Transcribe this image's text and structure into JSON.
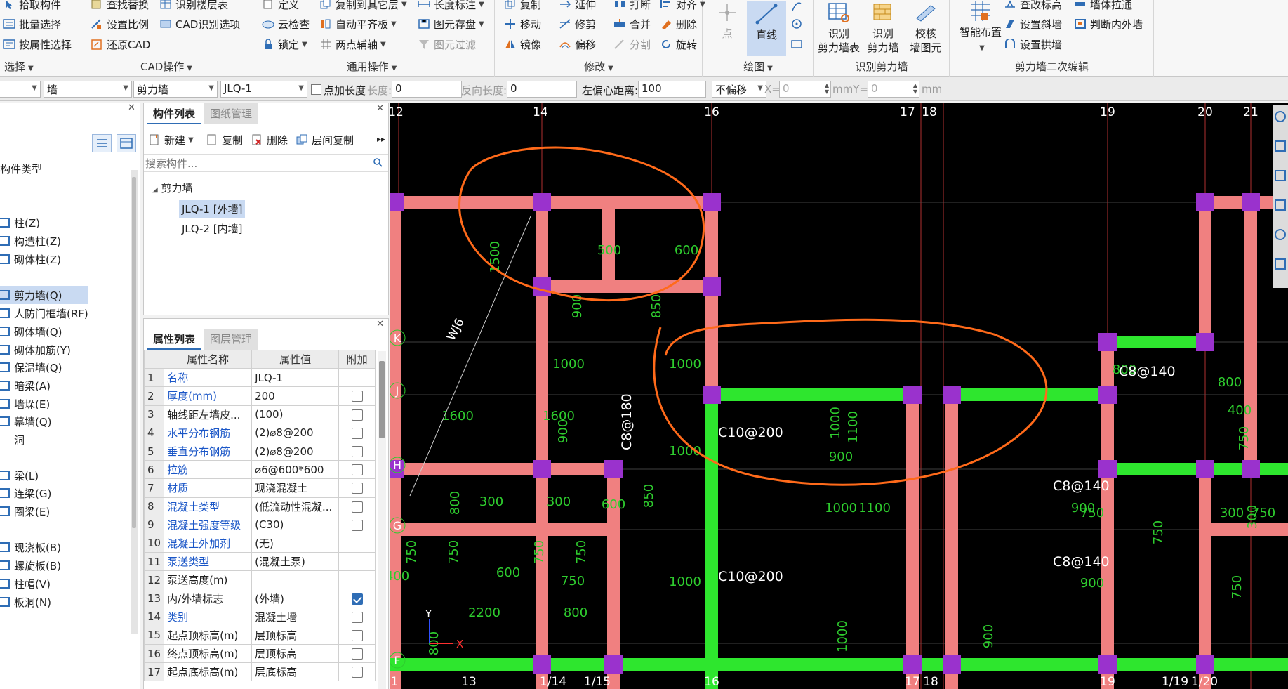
{
  "ribbon": {
    "select_group": {
      "items": [
        "拾取构件",
        "批量选择",
        "按属性选择"
      ],
      "title": "选择"
    },
    "cad_group": {
      "items": [
        "查找替换",
        "识别楼层表",
        "设置比例",
        "CAD识别选项",
        "还原CAD"
      ],
      "title": "CAD操作"
    },
    "common_group": {
      "items": [
        "定义",
        "复制到其它层",
        "长度标注",
        "云检查",
        "自动平齐板",
        "图元存盘",
        "锁定",
        "两点辅轴",
        "图元过滤"
      ],
      "title": "通用操作"
    },
    "modify_group": {
      "items": [
        "复制",
        "延伸",
        "打断",
        "对齐",
        "移动",
        "修剪",
        "合并",
        "删除",
        "镜像",
        "偏移",
        "分割",
        "旋转"
      ],
      "title": "修改"
    },
    "draw_group": {
      "items": [
        "点",
        "直线"
      ],
      "title": "绘图"
    },
    "recognize_group": {
      "items": [
        {
          "l1": "识别",
          "l2": "剪力墙表"
        },
        {
          "l1": "识别",
          "l2": "剪力墙"
        },
        {
          "l1": "校核",
          "l2": "墙图元"
        }
      ],
      "title": "识别剪力墙"
    },
    "second_edit_group": {
      "items": [
        "智能布置",
        "查改标高",
        "墙体拉通",
        "设置斜墙",
        "判断内外墙",
        "设置拱墙"
      ],
      "title": "剪力墙二次编辑"
    }
  },
  "options_bar": {
    "category": "墙",
    "type": "剪力墙",
    "component": "JLQ-1",
    "point_length_label": "点加长度",
    "length_label": "长度:",
    "length_value": "0",
    "reverse_length_label": "反向长度:",
    "reverse_length_value": "0",
    "left_offset_label": "左偏心距离:",
    "left_offset_value": "100",
    "offset_mode": "不偏移",
    "x_label": "X=",
    "x_value": "0",
    "mmy_label": "mmY=",
    "y_value": "0",
    "mm_label": "mm"
  },
  "left_nav": {
    "header": "构件类型",
    "items": [
      "柱(Z)",
      "构造柱(Z)",
      "砌体柱(Z)",
      "剪力墙(Q)",
      "人防门框墙(RF)",
      "砌体墙(Q)",
      "砌体加筋(Y)",
      "保温墙(Q)",
      "暗梁(A)",
      "墙垛(E)",
      "幕墙(Q)",
      "洞",
      "梁(L)",
      "连梁(G)",
      "圈梁(E)",
      "现浇板(B)",
      "螺旋板(B)",
      "柱帽(V)",
      "板洞(N)"
    ]
  },
  "component_list": {
    "tabs": [
      "构件列表",
      "图纸管理"
    ],
    "toolbar": [
      "新建",
      "复制",
      "删除",
      "层间复制"
    ],
    "search_placeholder": "搜索构件...",
    "tree_root": "剪力墙",
    "tree_items": [
      "JLQ-1 [外墙]",
      "JLQ-2 [内墙]"
    ]
  },
  "properties": {
    "tabs": [
      "属性列表",
      "图层管理"
    ],
    "headers": [
      "属性名称",
      "属性值",
      "附加"
    ],
    "rows": [
      {
        "num": "1",
        "name": "名称",
        "value": "JLQ-1",
        "link": true,
        "check": "none"
      },
      {
        "num": "2",
        "name": "厚度(mm)",
        "value": "200",
        "link": true,
        "check": "off"
      },
      {
        "num": "3",
        "name": "轴线距左墙皮...",
        "value": "(100)",
        "link": false,
        "check": "off"
      },
      {
        "num": "4",
        "name": "水平分布钢筋",
        "value": "(2)⌀8@200",
        "link": true,
        "check": "off"
      },
      {
        "num": "5",
        "name": "垂直分布钢筋",
        "value": "(2)⌀8@200",
        "link": true,
        "check": "off"
      },
      {
        "num": "6",
        "name": "拉筋",
        "value": "⌀6@600*600",
        "link": true,
        "check": "off"
      },
      {
        "num": "7",
        "name": "材质",
        "value": "现浇混凝土",
        "link": true,
        "check": "off"
      },
      {
        "num": "8",
        "name": "混凝土类型",
        "value": "(低流动性混凝...",
        "link": true,
        "check": "off"
      },
      {
        "num": "9",
        "name": "混凝土强度等级",
        "value": "(C30)",
        "link": true,
        "check": "off"
      },
      {
        "num": "10",
        "name": "混凝土外加剂",
        "value": "(无)",
        "link": true,
        "check": "none"
      },
      {
        "num": "11",
        "name": "泵送类型",
        "value": "(混凝土泵)",
        "link": true,
        "check": "none"
      },
      {
        "num": "12",
        "name": "泵送高度(m)",
        "value": "",
        "link": false,
        "check": "none"
      },
      {
        "num": "13",
        "name": "内/外墙标志",
        "value": "(外墙)",
        "link": false,
        "check": "on"
      },
      {
        "num": "14",
        "name": "类别",
        "value": "混凝土墙",
        "link": true,
        "check": "off"
      },
      {
        "num": "15",
        "name": "起点顶标高(m)",
        "value": "层顶标高",
        "link": false,
        "check": "off"
      },
      {
        "num": "16",
        "name": "终点顶标高(m)",
        "value": "层顶标高",
        "link": false,
        "check": "off"
      },
      {
        "num": "17",
        "name": "起点底标高(m)",
        "value": "层底标高",
        "link": false,
        "check": "off"
      }
    ]
  },
  "drawing": {
    "top_axes": [
      "12",
      "14",
      "16",
      "17",
      "18",
      "19",
      "20",
      "21"
    ],
    "side_axes": [
      "K",
      "J",
      "H",
      "G",
      "F"
    ],
    "bottom_axes": [
      "1",
      "13",
      "1/14",
      "1/15",
      "16",
      "17",
      "18",
      "19",
      "1/19",
      "1/20"
    ],
    "dims": [
      "1500",
      "500",
      "600",
      "900",
      "850",
      "1000",
      "1000",
      "1600",
      "1600",
      "900",
      "1000",
      "800",
      "300",
      "300",
      "600",
      "850",
      "1100",
      "1000",
      "900",
      "1100",
      "1000",
      "900",
      "800",
      "800",
      "400",
      "750",
      "750",
      "750",
      "750",
      "750",
      "600",
      "750",
      "1000",
      "2200",
      "800",
      "800",
      "400",
      "1000",
      "900",
      "900",
      "750",
      "750",
      "300",
      "300",
      "750",
      "750"
    ],
    "rebar_labels": [
      "C10@200",
      "C10@200",
      "C8@140",
      "C8@140",
      "C8@140",
      "C8@180"
    ],
    "beam_label": "WJ6",
    "ucs_y": "Y",
    "ucs_x": "X",
    "colors": {
      "wall": "#f08080",
      "wall_green": "#2ee62e",
      "column": "#9a32cd",
      "axis": "#b03030",
      "dim": "#2ecc2e",
      "annotation": "#ff6a1a"
    }
  }
}
